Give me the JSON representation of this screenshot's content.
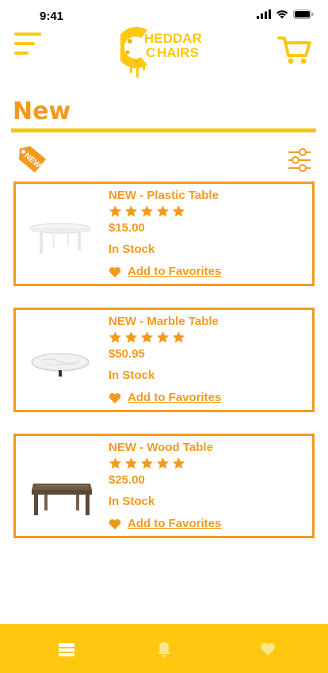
{
  "status_bar": {
    "time": "9:41",
    "icons": [
      "signal-icon",
      "wifi-icon",
      "battery-icon"
    ]
  },
  "header": {
    "menu_icon": "hamburger-menu-icon",
    "logo_text_line1": "HEDDAR",
    "logo_text_line2": "HAIRS",
    "logo_letter": "C",
    "cart_icon": "shopping-cart-icon"
  },
  "page": {
    "title": "New",
    "tag_label": "NEW",
    "filter_icon": "filter-sliders-icon"
  },
  "products": [
    {
      "title": "NEW - Plastic Table",
      "rating": 5,
      "price": "$15.00",
      "stock": "In Stock",
      "favorite_label": "Add to Favorites",
      "image": "plastic-table"
    },
    {
      "title": "NEW - Marble Table",
      "rating": 5,
      "price": "$50.95",
      "stock": "In Stock",
      "favorite_label": "Add to Favorites",
      "image": "marble-table"
    },
    {
      "title": "NEW - Wood Table",
      "rating": 5,
      "price": "$25.00",
      "stock": "In Stock",
      "favorite_label": "Add to Favorites",
      "image": "wood-table"
    }
  ],
  "bottom_nav": {
    "items": [
      "list-icon",
      "bell-icon",
      "heart-icon"
    ]
  },
  "colors": {
    "accent_orange": "#f39a1e",
    "brand_yellow": "#fdc80f",
    "rule_yellow": "#f7c417"
  }
}
